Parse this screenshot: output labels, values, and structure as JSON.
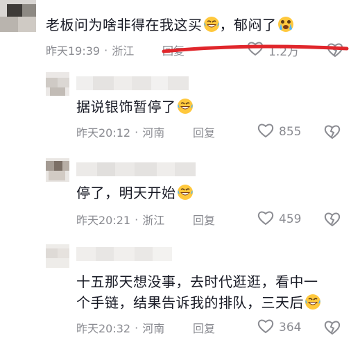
{
  "comments": [
    {
      "text": "老板问为啥非得在我这买",
      "text2": "，郁闷了",
      "time": "昨天19:39",
      "location": "浙江",
      "reply": "回复",
      "likes": "1.2万"
    },
    {
      "text": "据说银饰暂停了",
      "time": "昨天20:12",
      "location": "河南",
      "reply": "回复",
      "likes": "855"
    },
    {
      "text": "停了，明天开始",
      "time": "昨天20:21",
      "location": "浙江",
      "reply": "回复",
      "likes": "459"
    },
    {
      "text_line1": "十五那天想没事，去时代逛逛，看中一",
      "text_line2": "个手链，结果告诉我的排队，三天后",
      "time": "昨天20:32",
      "location": "河南",
      "reply": "回复",
      "likes": "364"
    }
  ],
  "separator": "·",
  "icons": {
    "emoji_cry_laugh": "rofl-emoji-icon",
    "emoji_tears": "tears-emoji-icon",
    "like": "heart-outline-icon",
    "dislike": "broken-heart-icon"
  },
  "colors": {
    "text": "#161823",
    "meta": "#8a8b91",
    "annotation": "#e0262b"
  }
}
